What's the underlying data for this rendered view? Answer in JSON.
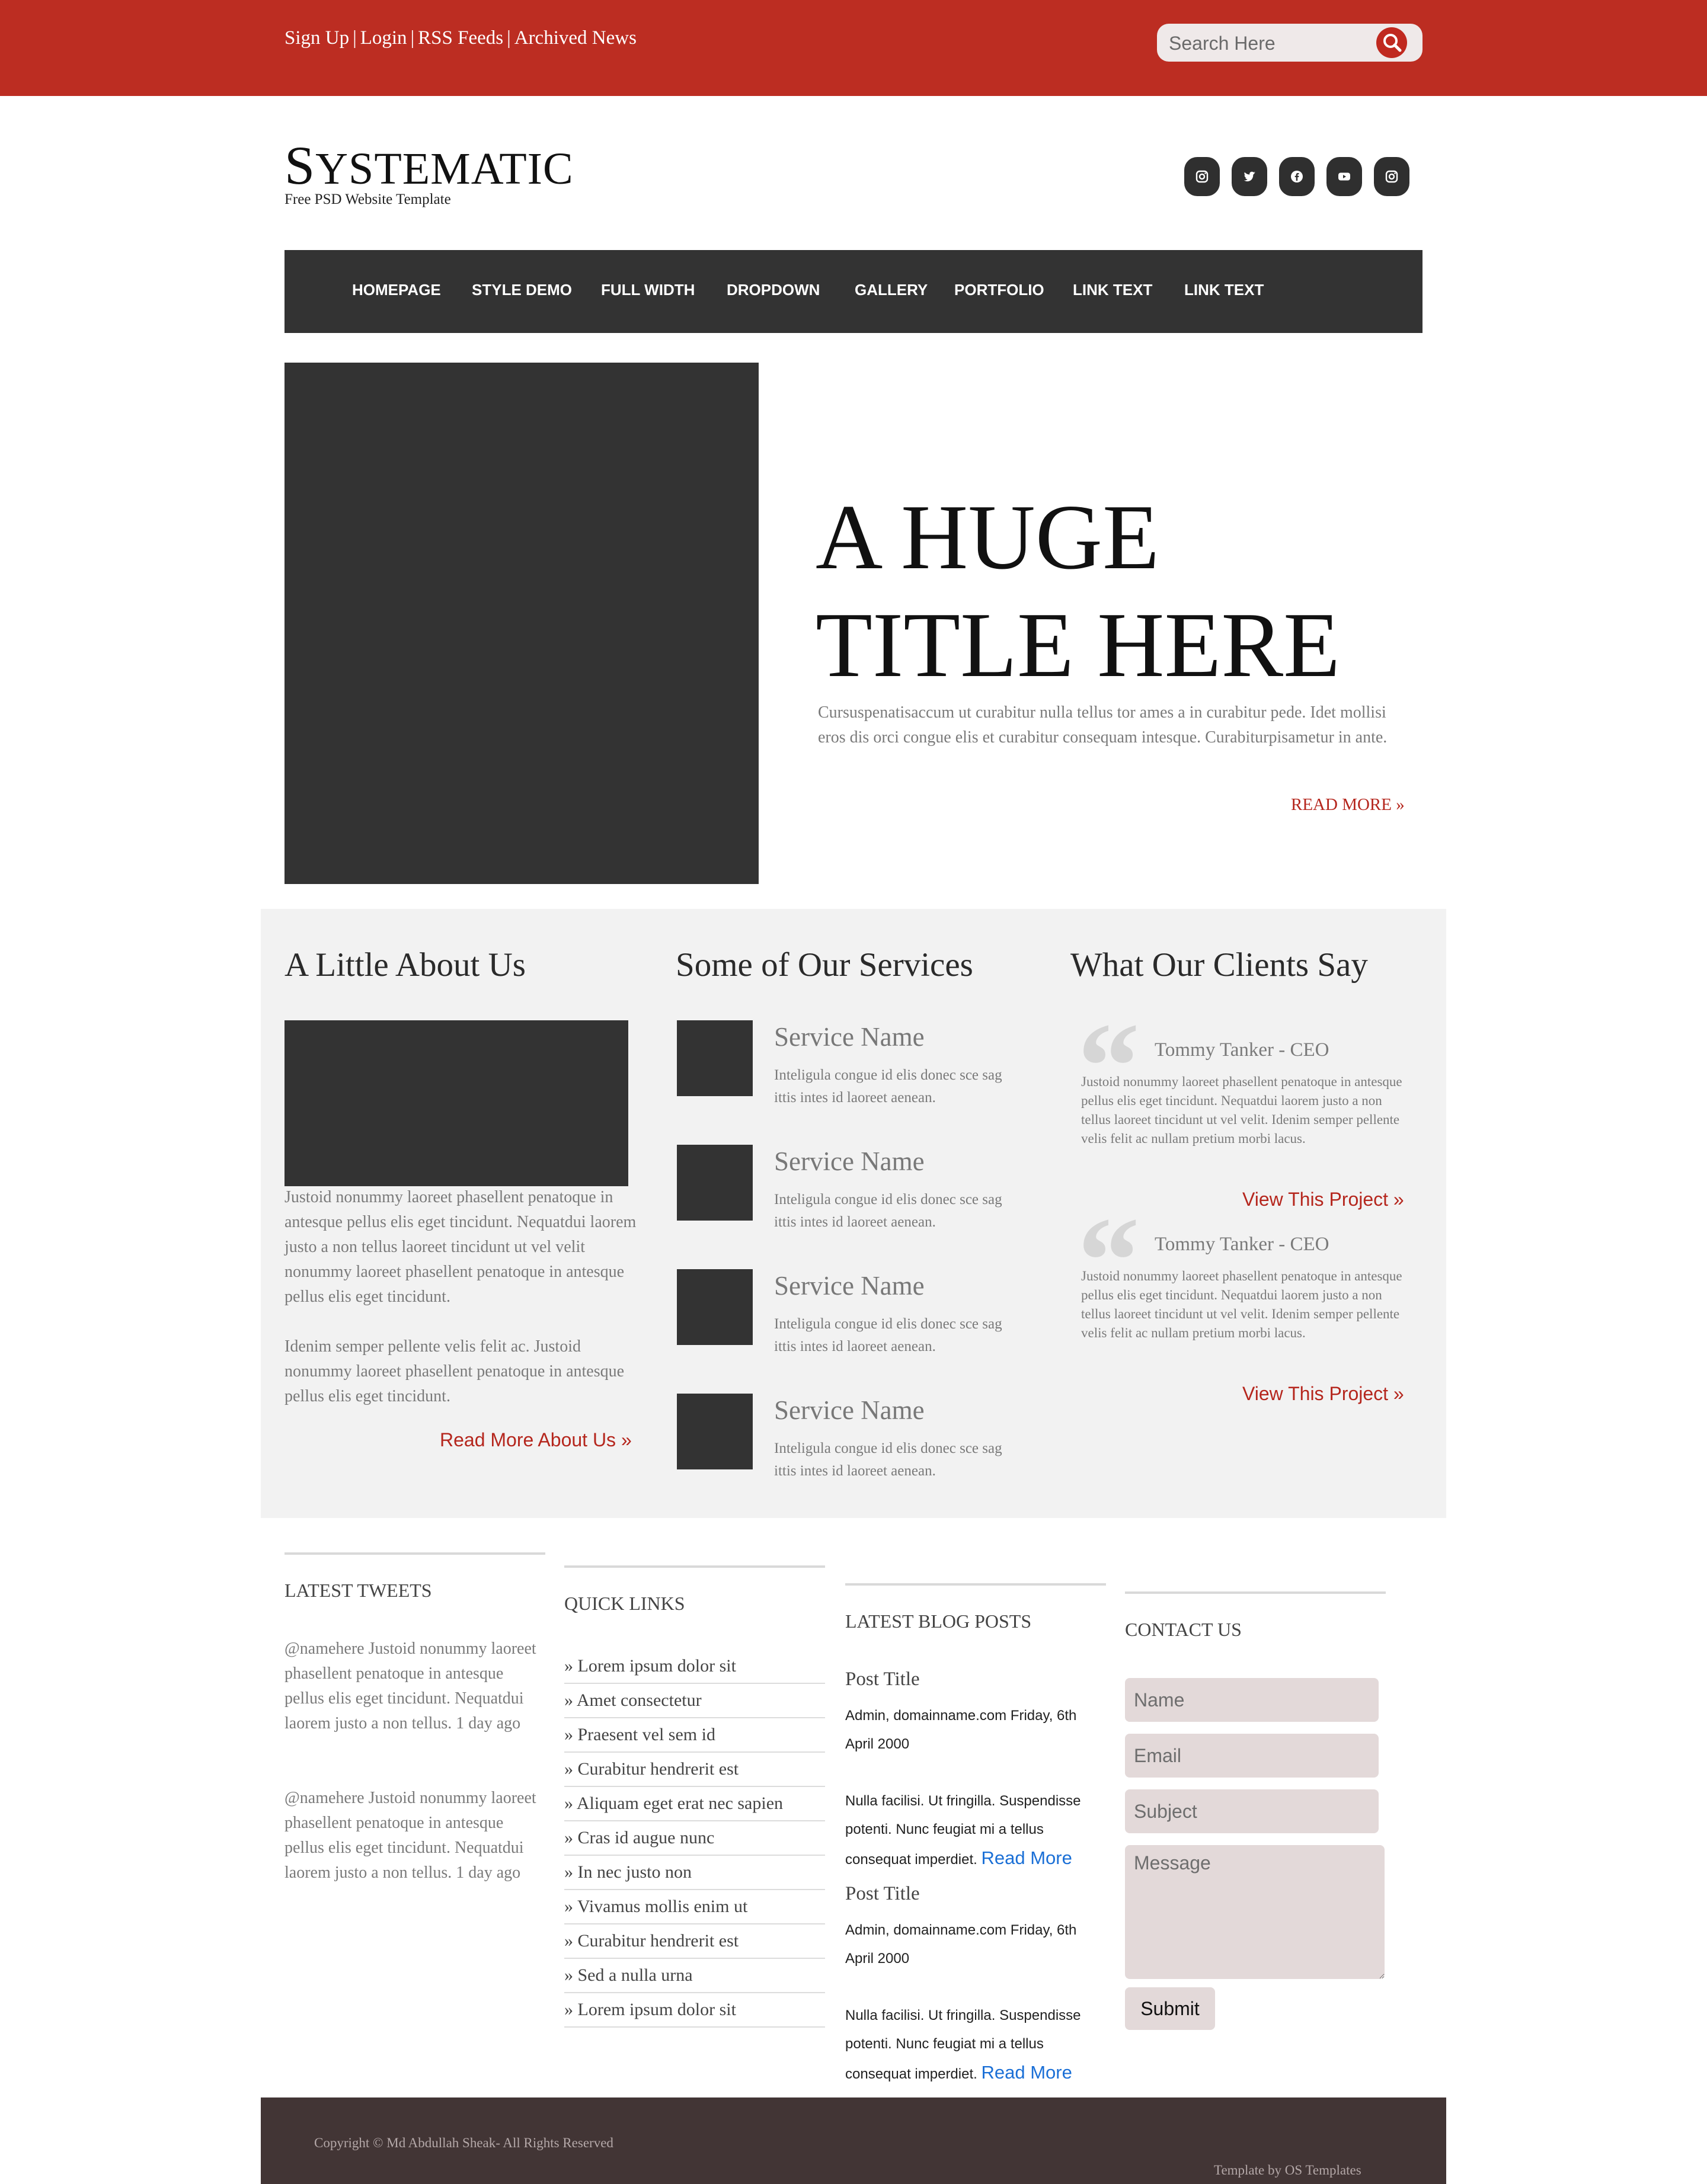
{
  "topbar": {
    "links": [
      "Sign Up",
      "Login",
      "RSS Feeds",
      "Archived News"
    ],
    "separator": "|",
    "search_placeholder": "Search Here",
    "search_icon": "search-icon"
  },
  "brand": {
    "logo_initial": "S",
    "logo_rest": "YSTEMATIC",
    "tagline": "Free PSD Website Template"
  },
  "social": [
    "instagram-icon",
    "twitter-icon",
    "facebook-icon",
    "youtube-icon",
    "instagram-icon"
  ],
  "nav": [
    "HOMEPAGE",
    "STYLE DEMO",
    "FULL WIDTH",
    "DROPDOWN",
    "GALLERY",
    "PORTFOLIO",
    "LINK TEXT",
    "LINK TEXT"
  ],
  "hero": {
    "title_line1": "A HUGE",
    "title_line2": "TITLE HERE",
    "text": "Cursuspenatisaccum ut curabitur nulla tellus tor ames a in curabitur pede. Idet mollisi eros dis orci congue elis et curabitur consequam intesque. Curabiturpisametur in ante.",
    "read_more": "READ MORE »"
  },
  "about": {
    "heading": "A Little About Us",
    "para1": "Justoid nonummy laoreet phasellent penatoque in antesque pellus elis eget tincidunt. Nequatdui laorem justo a non tellus laoreet tincidunt ut vel velit nonummy laoreet phasellent penatoque in antesque pellus elis eget tincidunt.",
    "para2": "Idenim semper pellente velis felit ac. Justoid nonummy laoreet phasellent penatoque in antesque pellus elis eget tincidunt.",
    "read_more": "Read More About Us »"
  },
  "services": {
    "heading": "Some of Our Services",
    "items": [
      {
        "name": "Service Name",
        "text": "Inteligula congue id elis donec sce sag ittis intes id laoreet aenean."
      },
      {
        "name": "Service Name",
        "text": "Inteligula congue id elis donec sce sag ittis intes id laoreet aenean."
      },
      {
        "name": "Service Name",
        "text": "Inteligula congue id elis donec sce sag ittis intes id laoreet aenean."
      },
      {
        "name": "Service Name",
        "text": "Inteligula congue id elis donec sce sag ittis intes id laoreet aenean."
      }
    ]
  },
  "clients": {
    "heading": "What Our Clients Say",
    "quote_mark": "“",
    "items": [
      {
        "name": "Tommy Tanker - CEO",
        "text": "Justoid nonummy laoreet phasellent penatoque in antesque pellus elis eget tincidunt. Nequatdui laorem justo a non tellus laoreet tincidunt ut vel velit. Idenim semper pellente velis felit ac nullam pretium morbi lacus.",
        "link": "View This Project »"
      },
      {
        "name": "Tommy Tanker - CEO",
        "text": "Justoid nonummy laoreet phasellent penatoque in antesque pellus elis eget tincidunt. Nequatdui laorem justo a non tellus laoreet tincidunt ut vel velit. Idenim semper pellente velis felit ac nullam pretium morbi lacus.",
        "link": "View This Project »"
      }
    ]
  },
  "tweets": {
    "heading": "LATEST TWEETS",
    "items": [
      "@namehere Justoid nonummy laoreet phasellent penatoque in antesque pellus elis eget tincidunt. Nequatdui laorem justo a non tellus. 1 day ago",
      "@namehere Justoid nonummy laoreet phasellent penatoque in antesque pellus elis eget tincidunt. Nequatdui laorem justo a non tellus. 1 day ago"
    ]
  },
  "quick_links": {
    "heading": "QUICK LINKS",
    "items": [
      "» Lorem ipsum dolor sit",
      "» Amet consectetur",
      "» Praesent vel sem id",
      "» Curabitur hendrerit est",
      "» Aliquam eget erat nec sapien",
      "» Cras id augue nunc",
      "» In nec justo non",
      "» Vivamus mollis enim ut",
      "» Curabitur hendrerit est",
      "» Sed a nulla urna",
      "» Lorem ipsum dolor sit"
    ]
  },
  "blog": {
    "heading": "LATEST BLOG POSTS",
    "posts": [
      {
        "title": "Post Title",
        "meta": "Admin, domainname.com Friday, 6th April 2000",
        "text": "Nulla facilisi. Ut fringilla. Suspendisse potenti. Nunc feugiat mi a tellus consequat imperdiet.",
        "read_more": "Read More"
      },
      {
        "title": "Post Title",
        "meta": "Admin, domainname.com Friday, 6th April 2000",
        "text": "Nulla facilisi. Ut fringilla. Suspendisse potenti. Nunc feugiat mi a tellus consequat imperdiet.",
        "read_more": "Read More"
      }
    ]
  },
  "contact": {
    "heading": "CONTACT US",
    "name_placeholder": "Name",
    "email_placeholder": "Email",
    "subject_placeholder": "Subject",
    "message_placeholder": "Message",
    "submit": "Submit"
  },
  "footer": {
    "copyright": "Copyright © Md Abdullah Sheak- All Rights Reserved",
    "credit": "Template by OS Templates"
  },
  "colors": {
    "brand_red": "#bc2d22",
    "dark": "#333333",
    "footer": "#423535",
    "link_blue": "#1a6fd6"
  }
}
